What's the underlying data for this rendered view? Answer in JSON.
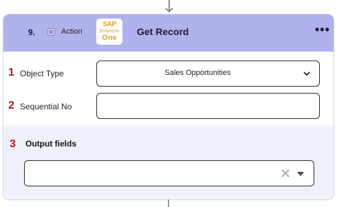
{
  "step": {
    "number": "9.",
    "type_label": "Action",
    "title": "Get Record"
  },
  "logo": {
    "line1": "SAP",
    "line2": "Business",
    "line3": "One"
  },
  "menu": {
    "icon": "more-icon",
    "glyph": "•••"
  },
  "fields": [
    {
      "number": "1",
      "label": "Object Type",
      "value": "Sales Opportunities",
      "kind": "select"
    },
    {
      "number": "2",
      "label": "Sequential No",
      "value": "",
      "kind": "text"
    }
  ],
  "output": {
    "number": "3",
    "title": "Output fields",
    "value": ""
  },
  "colors": {
    "header": "#b0b2ee",
    "marker": "#c0101a",
    "logo": "#e9a21a"
  }
}
